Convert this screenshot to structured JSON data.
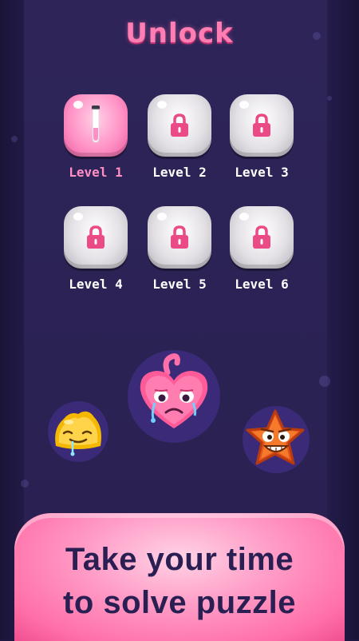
{
  "title": "Unlock",
  "levels": [
    {
      "label": "Level 1",
      "state": "unlocked"
    },
    {
      "label": "Level 2",
      "state": "locked"
    },
    {
      "label": "Level 3",
      "state": "locked"
    },
    {
      "label": "Level 4",
      "state": "locked"
    },
    {
      "label": "Level 5",
      "state": "locked"
    },
    {
      "label": "Level 6",
      "state": "locked"
    }
  ],
  "icons": {
    "locked": "lock-icon",
    "unlocked": "test-tube-icon"
  },
  "characters": [
    "yellow-jelly-character",
    "pink-heart-character",
    "orange-star-character"
  ],
  "banner": {
    "line1": "Take your time",
    "line2": "to solve puzzle"
  },
  "colors": {
    "background": "#2b2254",
    "accent_pink": "#ff7fb5",
    "banner_text": "#2a1f52",
    "lock": "#ea4b86"
  }
}
